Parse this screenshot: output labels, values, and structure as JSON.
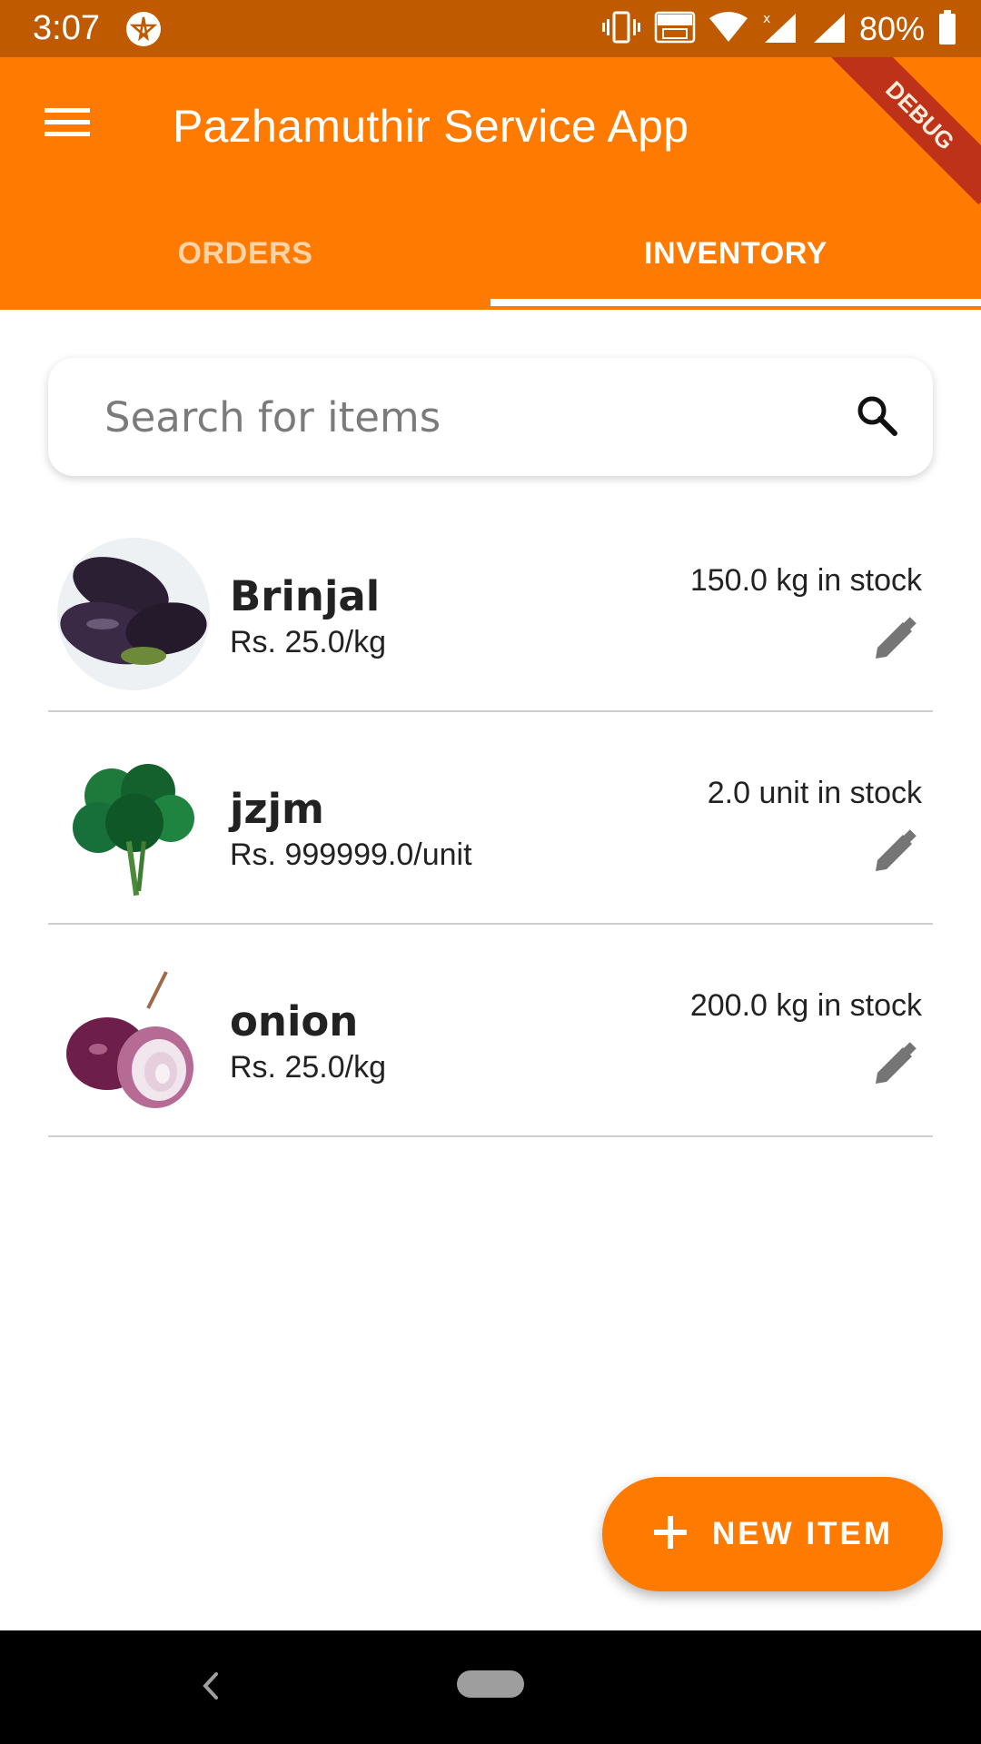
{
  "status_bar": {
    "time": "3:07",
    "battery": "80%",
    "icons": [
      "app-notification-icon",
      "vibrate-icon",
      "volte-icon",
      "wifi-icon",
      "signal-icon",
      "signal-icon",
      "battery-icon"
    ]
  },
  "app_bar": {
    "title": "Pazhamuthir Service App",
    "menu_icon": "menu-icon",
    "debug_label": "DEBUG",
    "color": "#ff7a00"
  },
  "tabs": [
    {
      "label": "ORDERS",
      "selected": false
    },
    {
      "label": "INVENTORY",
      "selected": true
    }
  ],
  "search": {
    "placeholder": "Search for items",
    "value": "",
    "icon": "search-icon"
  },
  "items": [
    {
      "name": "Brinjal",
      "price": "Rs. 25.0/kg",
      "stock": "150.0 kg in stock",
      "image": "brinjal"
    },
    {
      "name": "jzjm",
      "price": "Rs. 999999.0/unit",
      "stock": "2.0 unit in stock",
      "image": "greens"
    },
    {
      "name": "onion",
      "price": "Rs. 25.0/kg",
      "stock": "200.0 kg in stock",
      "image": "onion"
    }
  ],
  "fab": {
    "label": "NEW ITEM",
    "icon": "plus-icon"
  },
  "nav": {
    "back_icon": "back-icon",
    "home_icon": "home-pill-icon"
  }
}
